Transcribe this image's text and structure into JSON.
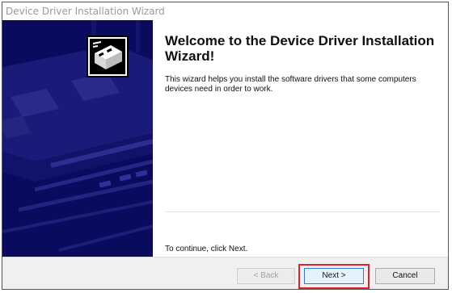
{
  "window": {
    "title": "Device Driver Installation Wizard"
  },
  "content": {
    "heading": "Welcome to the Device Driver Installation Wizard!",
    "description": "This wizard helps you install the software drivers that some computers devices need in order to work.",
    "continue_text": "To continue, click Next."
  },
  "buttons": {
    "back_label": "< Back",
    "next_label": "Next >",
    "cancel_label": "Cancel"
  },
  "icons": {
    "sidebar_icon": "driver-install-icon",
    "sidebar_art": "circuit-board-art"
  },
  "colors": {
    "sidebar_background": "#0a0a5e",
    "highlight": "#e0202a",
    "title_text": "#9a9a9a"
  }
}
